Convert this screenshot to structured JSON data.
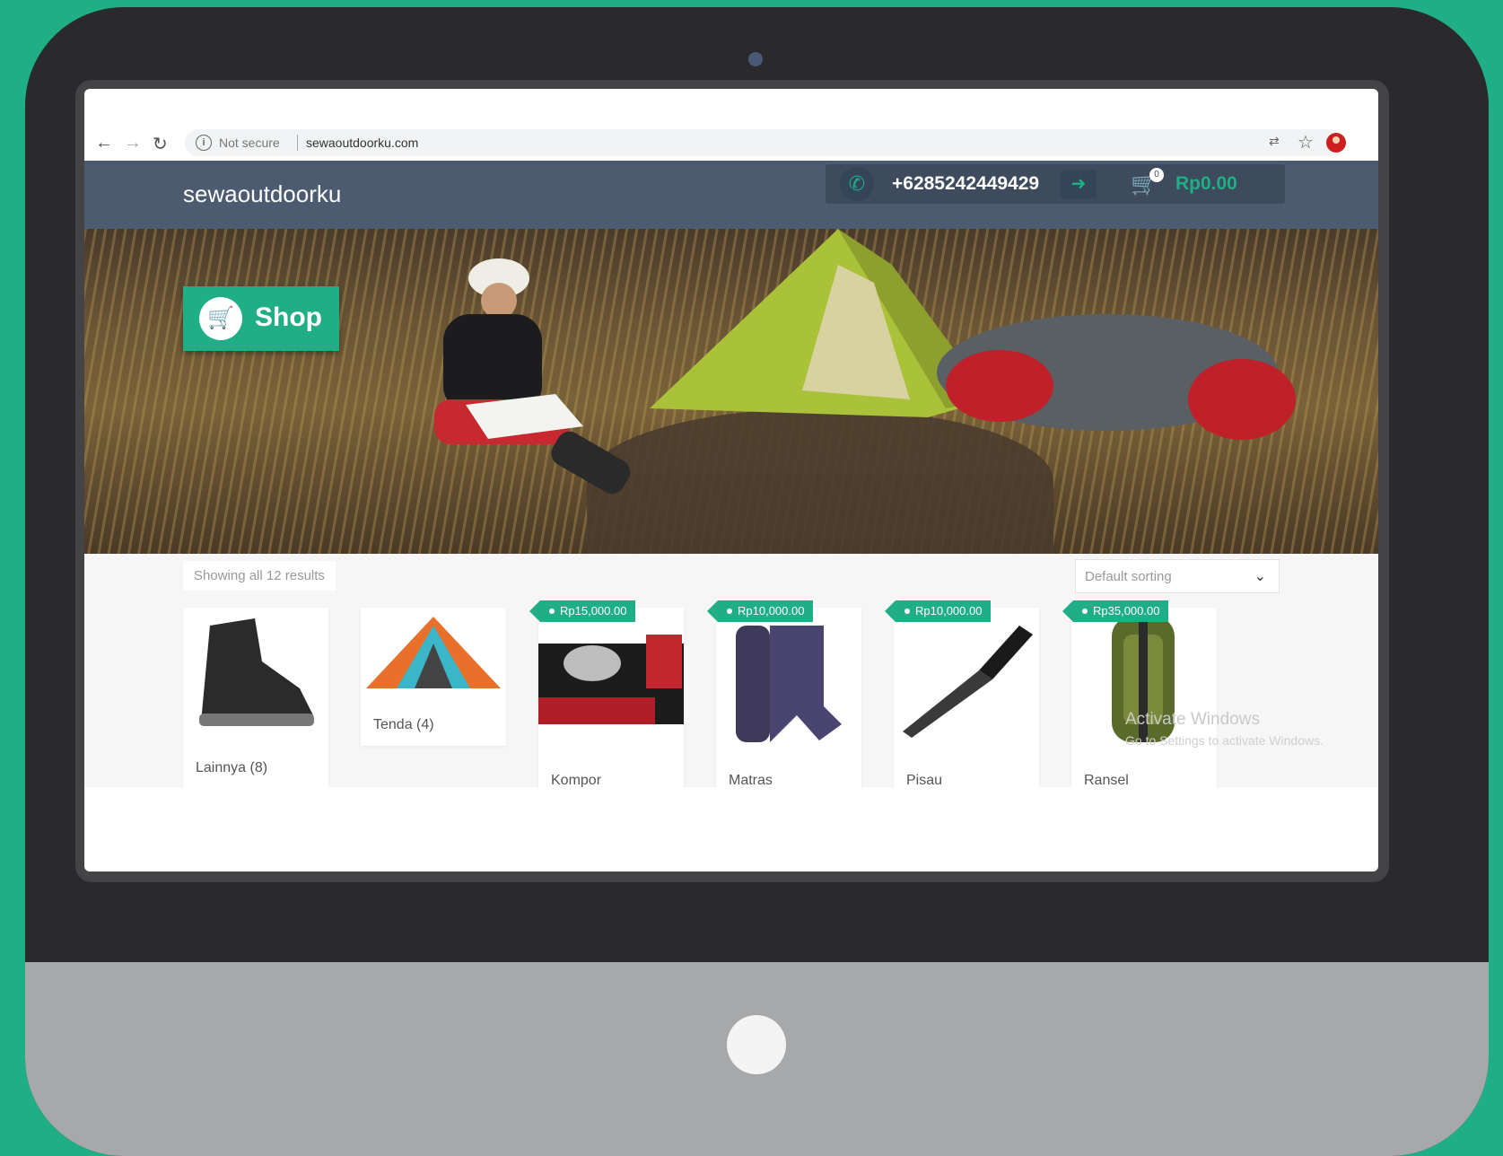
{
  "browser": {
    "security": "Not secure",
    "url": "sewaoutdoorku.com"
  },
  "header": {
    "brand": "sewaoutdoorku",
    "phone": "+6285242449429",
    "cart_count": "0",
    "cart_total": "Rp0.00"
  },
  "hero": {
    "shop_label": "Shop"
  },
  "shop": {
    "result_count": "Showing all 12 results",
    "sort_selected": "Default sorting",
    "products": [
      {
        "name": "Lainnya (8)",
        "price": ""
      },
      {
        "name": "Tenda (4)",
        "price": ""
      },
      {
        "name": "Kompor",
        "price": "Rp15,000.00"
      },
      {
        "name": "Matras",
        "price": "Rp10,000.00"
      },
      {
        "name": "Pisau",
        "price": "Rp10,000.00"
      },
      {
        "name": "Ransel",
        "price": "Rp35,000.00"
      }
    ]
  },
  "watermark": {
    "title": "Activate Windows",
    "subtitle": "Go to Settings to activate Windows."
  },
  "colors": {
    "background": "#1fae86",
    "accent": "#1fae86",
    "header": "#4c5b70",
    "bezel": "#2a2a2c",
    "chin": "#a7a8aa"
  }
}
